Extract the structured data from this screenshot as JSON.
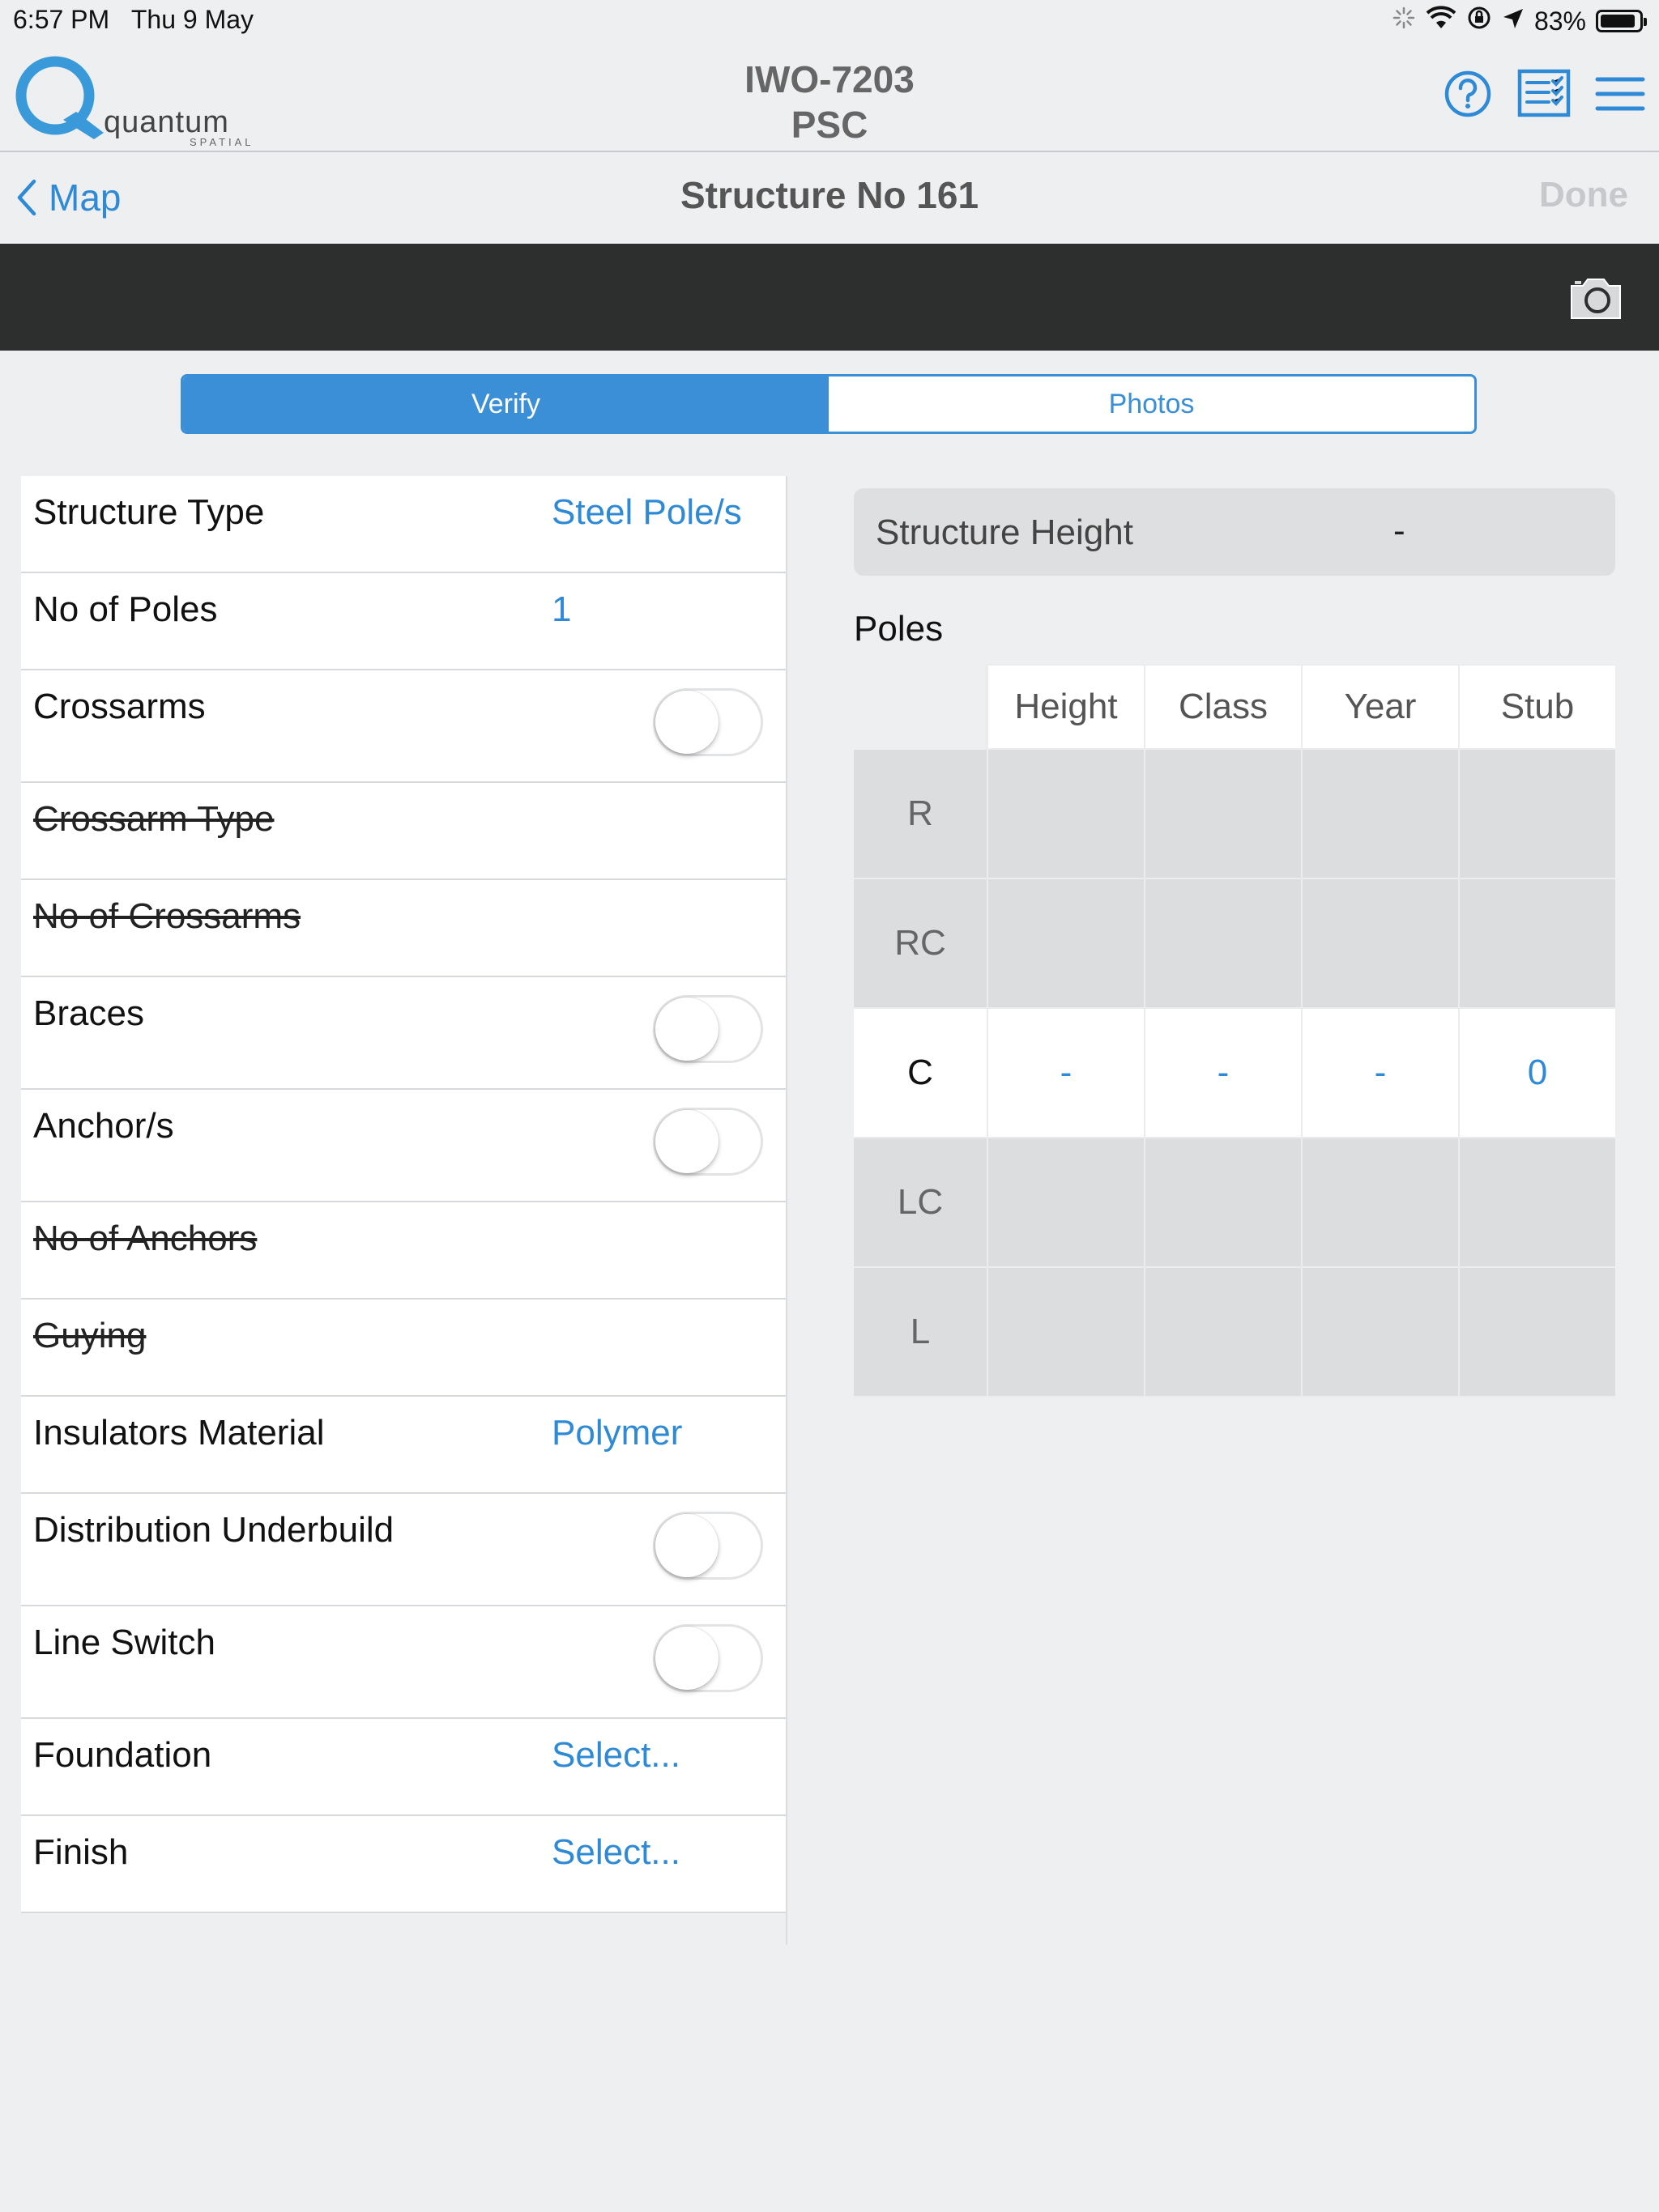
{
  "status_bar": {
    "time": "6:57 PM",
    "date": "Thu 9 May",
    "battery": "83%",
    "icons": [
      "activity-icon",
      "wifi-icon",
      "rotation-lock-icon",
      "location-icon",
      "battery-icon"
    ]
  },
  "header": {
    "logo_text": "quantum",
    "logo_subtext": "SPATIAL",
    "title_line1": "IWO-7203",
    "title_line2": "PSC",
    "icons": [
      "help-icon",
      "checklist-icon",
      "menu-icon"
    ]
  },
  "nav": {
    "back_label": "Map",
    "title": "Structure No 161",
    "done_label": "Done"
  },
  "segments": {
    "verify": "Verify",
    "photos": "Photos",
    "active": "verify"
  },
  "fields": [
    {
      "label": "Structure Type",
      "type": "value",
      "value": "Steel Pole/s",
      "enabled": true
    },
    {
      "label": "No of Poles",
      "type": "value",
      "value": "1",
      "enabled": true
    },
    {
      "label": "Crossarms",
      "type": "toggle",
      "value": "off",
      "enabled": true
    },
    {
      "label": "Crossarm Type",
      "type": "none",
      "enabled": false
    },
    {
      "label": "No of Crossarms",
      "type": "none",
      "enabled": false
    },
    {
      "label": "Braces",
      "type": "toggle",
      "value": "off",
      "enabled": true
    },
    {
      "label": "Anchor/s",
      "type": "toggle",
      "value": "off",
      "enabled": true
    },
    {
      "label": "No of Anchors",
      "type": "none",
      "enabled": false
    },
    {
      "label": "Guying",
      "type": "none",
      "enabled": false
    },
    {
      "label": "Insulators Material",
      "type": "value",
      "value": "Polymer",
      "enabled": true
    },
    {
      "label": "Distribution Underbuild",
      "type": "toggle",
      "value": "off",
      "enabled": true
    },
    {
      "label": "Line Switch",
      "type": "toggle",
      "value": "off",
      "enabled": true
    },
    {
      "label": "Foundation",
      "type": "value",
      "value": "Select...",
      "enabled": true
    },
    {
      "label": "Finish",
      "type": "value",
      "value": "Select...",
      "enabled": true
    }
  ],
  "structure_height": {
    "label": "Structure Height",
    "value": "-"
  },
  "poles": {
    "title": "Poles",
    "columns": [
      "Height",
      "Class",
      "Year",
      "Stub"
    ],
    "rows": [
      {
        "label": "R",
        "enabled": false,
        "values": [
          "",
          "",
          "",
          ""
        ]
      },
      {
        "label": "RC",
        "enabled": false,
        "values": [
          "",
          "",
          "",
          ""
        ]
      },
      {
        "label": "C",
        "enabled": true,
        "values": [
          "-",
          "-",
          "-",
          "0"
        ]
      },
      {
        "label": "LC",
        "enabled": false,
        "values": [
          "",
          "",
          "",
          ""
        ]
      },
      {
        "label": "L",
        "enabled": false,
        "values": [
          "",
          "",
          "",
          ""
        ]
      }
    ]
  },
  "colors": {
    "accent": "#3a8fd6",
    "link": "#2f8ad6",
    "toolbar": "#2d2f2f",
    "background": "#eeeff1",
    "disabled_cell": "#dcdddf"
  }
}
